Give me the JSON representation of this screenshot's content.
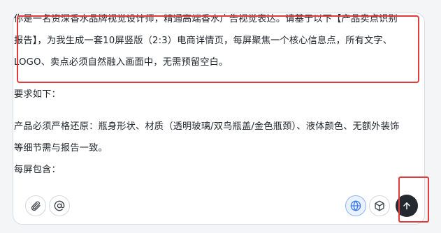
{
  "prompt": {
    "highlighted_paragraph": "你是一名资深香水品牌视觉设计师，精通高端香水广告视觉表达。请基于以下【产品卖点识别报告】，为我生成一套10屏竖版（2:3）电商详情页，每屏聚焦一个核心信息点，所有文字、LOGO、卖点必须自然融入画面中，无需预留空白。",
    "requirements_heading": "要求如下：",
    "requirement_1": "产品必须严格还原：瓶身形状、材质（透明玻璃/双鸟瓶盖/金色瓶颈）、液体颜色、无额外装饰等细节需与报告一致。",
    "per_screen": "每屏包含："
  },
  "toolbar": {
    "attach_icon": "paperclip-icon",
    "mention_icon": "at-sign-icon",
    "web_icon": "globe-icon",
    "cube_icon": "cube-icon",
    "send_icon": "arrow-up-icon"
  },
  "colors": {
    "highlight": "#e23b3b",
    "send_button": "#24282f",
    "active_tool": "#3b7ae8"
  }
}
